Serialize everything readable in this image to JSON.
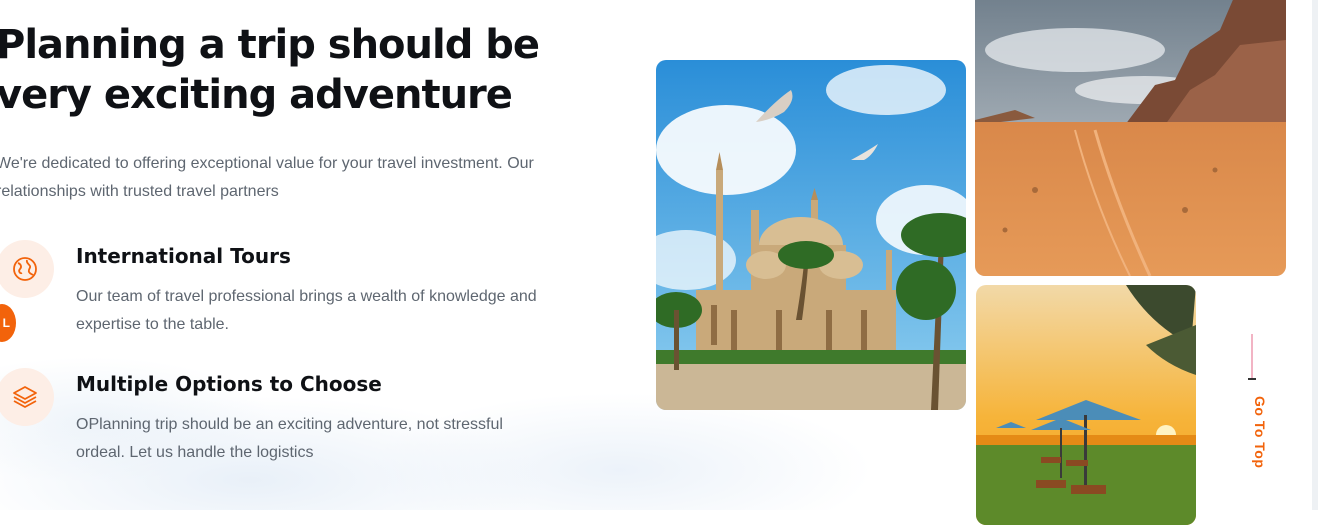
{
  "heading": "Planning a trip should be very exciting adventure",
  "intro": "We're dedicated to offering exceptional value for your travel investment. Our relationships with trusted travel partners",
  "features": [
    {
      "icon": "globe-icon",
      "title": "International Tours",
      "description": "Our team of travel professional brings a wealth of knowledge and expertise to the table."
    },
    {
      "icon": "layers-icon",
      "title": "Multiple Options to Choose",
      "description": "OPlanning trip should be an exciting adventure, not stressful ordeal. Let us handle the logistics"
    }
  ],
  "language_badge": "L",
  "go_to_top": "Go To Top",
  "colors": {
    "accent": "#f2630b",
    "icon_bg": "#fdeee6",
    "heading": "#0f1115",
    "body_text": "#5e6670"
  }
}
